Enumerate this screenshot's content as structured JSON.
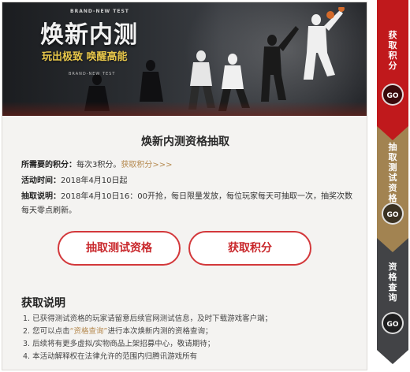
{
  "banner": {
    "brand_small": "BRAND-NEW TEST",
    "title": "焕新内测",
    "slogan": "玩出极致 唤醒高能",
    "brand_small2": "BRAND-NEW TEST"
  },
  "qualification": {
    "title": "焕新内测资格抽取",
    "points_label": "所需要的积分：",
    "points_value": "每次3积分。",
    "points_link": "获取积分>>>",
    "time_label": "活动时间：",
    "time_value": "2018年4月10日起",
    "desc_label": "抽取说明：",
    "desc_value": "2018年4月10日16：00开抢，每日限量发放，每位玩家每天可抽取一次，抽奖次数每天零点刷新。"
  },
  "buttons": {
    "draw_label": "抽取测试资格",
    "get_points_label": "获取积分"
  },
  "notes": {
    "title": "获取说明",
    "items": [
      "1. 已获得测试资格的玩家请留意后续官网测试信息，及时下载游戏客户端；",
      "2. 您可以点击",
      "“资格查询”",
      "进行本次焕新内测的资格查询；",
      "3. 后续将有更多虚拟/实物商品上架招募中心，敬请期待；",
      "4. 本活动解释权在法律允许的范围内归腾讯游戏所有"
    ]
  },
  "sidenav": {
    "items": [
      {
        "label": "获取积分",
        "go": "GO",
        "color": "#c0191c"
      },
      {
        "label": "抽取测试资格",
        "go": "GO",
        "color": "#a28351"
      },
      {
        "label": "资格查询",
        "go": "GO",
        "color": "#424346"
      }
    ]
  },
  "colors": {
    "accent_red": "#d3383b",
    "link_gold": "#b4884d"
  }
}
